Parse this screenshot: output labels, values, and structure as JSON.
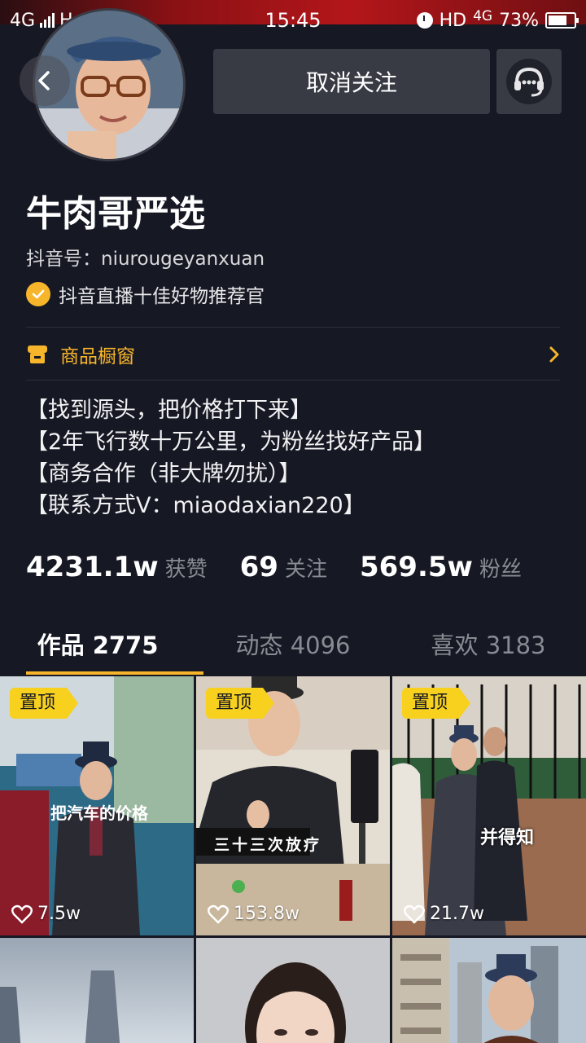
{
  "status_bar": {
    "network_left": "4G",
    "network_mid": "H",
    "sim_label": "S",
    "time": "15:45",
    "hd_label": "HD",
    "network_right": "4G",
    "battery_percent": "73%",
    "battery_level": 0.73
  },
  "header": {
    "unfollow_label": "取消关注"
  },
  "profile": {
    "nickname": "牛肉哥严选",
    "douyin_id": "抖音号：niurougeyanxuan",
    "verification": "抖音直播十佳好物推荐官",
    "shop_label": "商品橱窗",
    "bio": [
      "【找到源头，把价格打下来】",
      "【2年飞行数十万公里，为粉丝找好产品】",
      "【商务合作（非大牌勿扰）】",
      "【联系方式V：miaodaxian220】"
    ]
  },
  "stats": {
    "likes_num": "4231.1w",
    "likes_label": "获赞",
    "following_num": "69",
    "following_label": "关注",
    "fans_num": "569.5w",
    "fans_label": "粉丝"
  },
  "tabs": [
    {
      "label": "作品 2775"
    },
    {
      "label": "动态 4096"
    },
    {
      "label": "喜欢 3183"
    }
  ],
  "videos": [
    {
      "pinned": "置顶",
      "caption": "把汽车的价格",
      "likes": "7.5w"
    },
    {
      "pinned": "置顶",
      "caption": "三十三次放疗",
      "likes": "153.8w"
    },
    {
      "pinned": "置顶",
      "caption": "并得知",
      "likes": "21.7w"
    }
  ],
  "colors": {
    "background": "#161823",
    "accent": "#f7b52b",
    "pin_badge": "#f7d11e",
    "button_bg": "#393b44"
  }
}
